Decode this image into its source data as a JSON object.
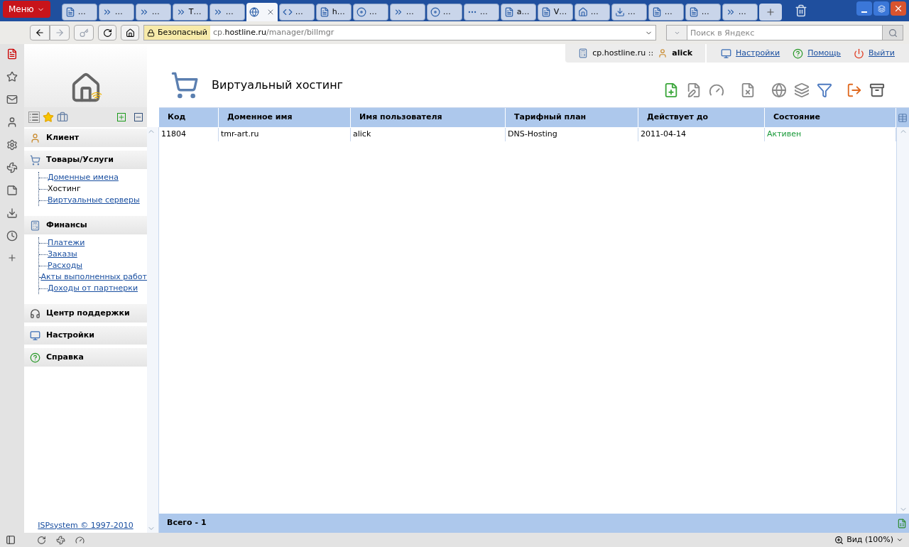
{
  "browser": {
    "menu_label": "Меню",
    "tabs": [
      {
        "kind": "fd",
        "label": "…",
        "selected": false
      },
      {
        "kind": "speed",
        "label": "…",
        "selected": false
      },
      {
        "kind": "speed",
        "label": "…",
        "selected": false
      },
      {
        "kind": "speed",
        "label": "T…",
        "selected": false
      },
      {
        "kind": "speed",
        "label": "…",
        "selected": false
      },
      {
        "kind": "globe",
        "selected": true
      },
      {
        "kind": "code",
        "label": "…",
        "selected": false
      },
      {
        "kind": "doc",
        "label": "h…",
        "selected": false
      },
      {
        "kind": "disc",
        "label": "…",
        "selected": false
      },
      {
        "kind": "speed",
        "label": "…",
        "selected": false
      },
      {
        "kind": "disc",
        "label": "…",
        "selected": false
      },
      {
        "kind": "dots",
        "label": "…",
        "selected": false
      },
      {
        "kind": "ya",
        "label": "a…",
        "selected": false
      },
      {
        "kind": "v",
        "label": "V…",
        "selected": false
      },
      {
        "kind": "house",
        "label": "…",
        "selected": false
      },
      {
        "kind": "down",
        "label": "…",
        "selected": false
      },
      {
        "kind": "doc",
        "label": "…",
        "selected": false
      },
      {
        "kind": "doc",
        "label": "…",
        "selected": false
      },
      {
        "kind": "speed",
        "label": "…",
        "selected": false
      }
    ],
    "security": "Безопасный",
    "url": {
      "prefix": "cp.",
      "domain": "hostline.ru",
      "path": "/manager/billmgr"
    },
    "search": {
      "placeholder": "Поиск в Яндекс"
    },
    "zoom": "Вид (100%)"
  },
  "sidebar": {
    "sections": [
      {
        "title": "Клиент"
      },
      {
        "title": "Товары/Услуги",
        "items": [
          {
            "label": "Доменные имена",
            "selected": false
          },
          {
            "label": "Хостинг",
            "selected": true
          },
          {
            "label": "Виртуальные серверы",
            "selected": false
          }
        ]
      },
      {
        "title": "Финансы",
        "items": [
          {
            "label": "Платежи",
            "selected": false
          },
          {
            "label": "Заказы",
            "selected": false
          },
          {
            "label": "Расходы",
            "selected": false
          },
          {
            "label": "Акты выполненных работ",
            "selected": false
          },
          {
            "label": "Доходы от партнерки",
            "selected": false
          }
        ]
      },
      {
        "title": "Центр поддержки"
      },
      {
        "title": "Настройки"
      },
      {
        "title": "Справка"
      }
    ],
    "footer": "ISPsystem © 1997-2010"
  },
  "header": {
    "host": "cp.hostline.ru ::",
    "user": "alick",
    "links": [
      "Настройки",
      "Помощь",
      "Выйти"
    ]
  },
  "title": "Виртуальный хостинг",
  "table": {
    "columns": [
      "Код",
      "Доменное имя",
      "Имя пользователя",
      "Тарифный план",
      "Действует до",
      "Состояние"
    ],
    "rows": [
      {
        "cells": [
          "11804",
          "tmr-art.ru",
          "alick",
          "DNS-Hosting",
          "2011-04-14",
          "Активен"
        ],
        "color": "#1a9a3a"
      }
    ],
    "footer": "Всего - 1"
  }
}
